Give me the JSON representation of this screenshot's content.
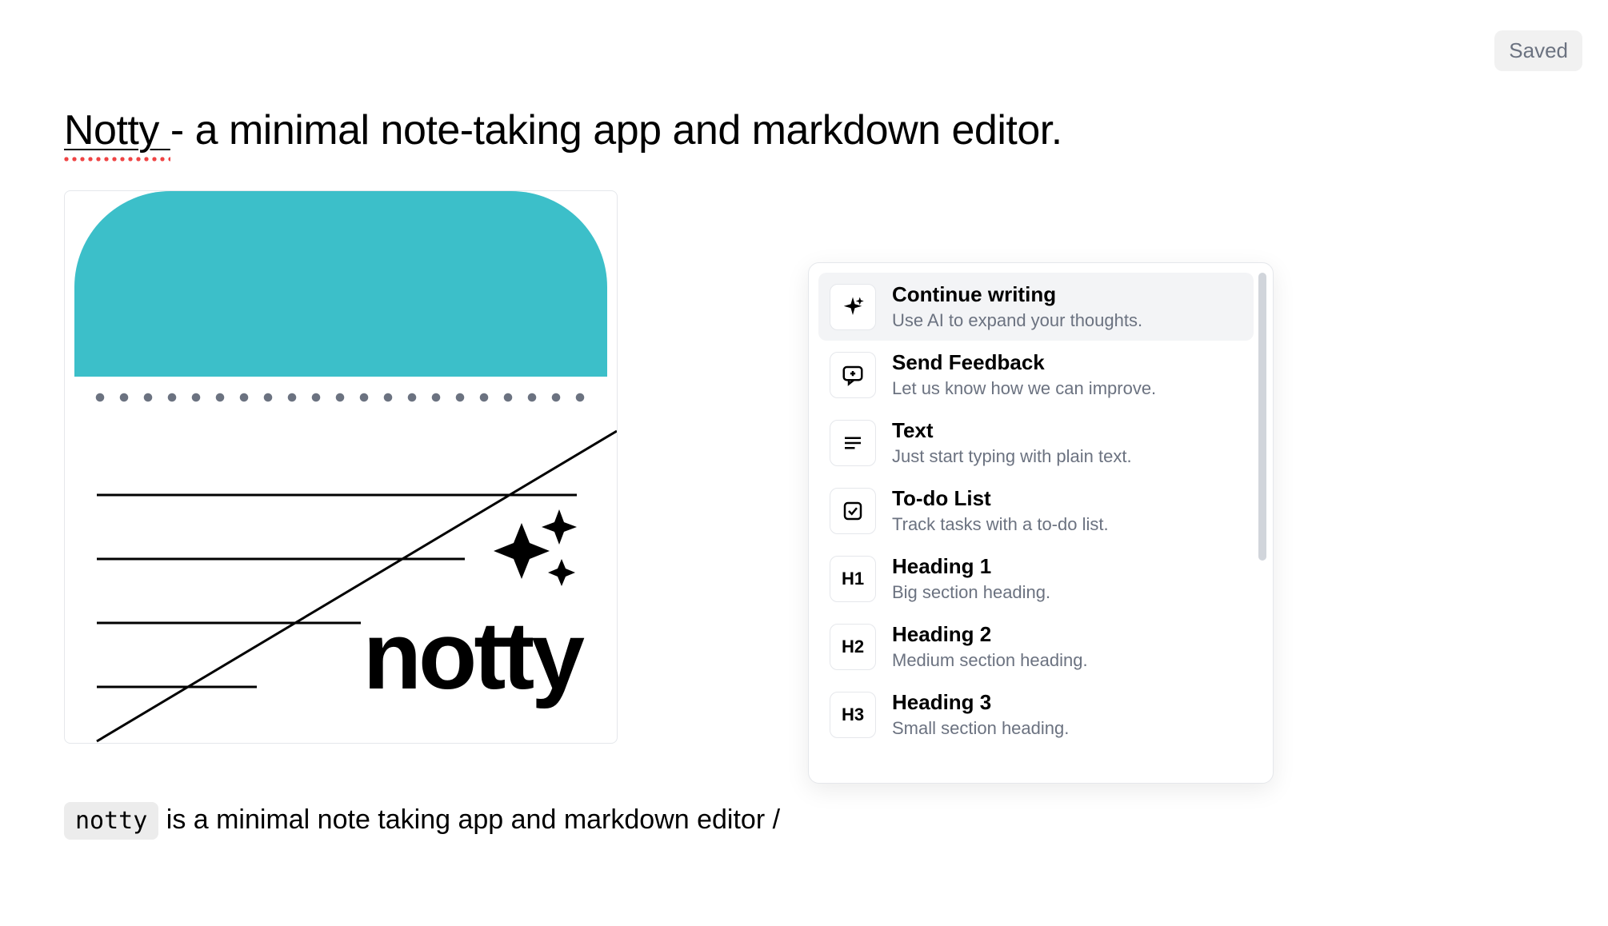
{
  "status": {
    "saved_label": "Saved"
  },
  "title": {
    "word": "Notty",
    "rest": " - a minimal note-taking app and markdown editor."
  },
  "logo": {
    "brand_word": "notty",
    "accent_color": "#3cbfc9"
  },
  "body": {
    "code": "notty",
    "text": " is a minimal note taking app and markdown editor /"
  },
  "slash_menu": {
    "selected_index": 0,
    "items": [
      {
        "icon": "sparkle-icon",
        "title": "Continue writing",
        "desc": "Use AI to expand your thoughts."
      },
      {
        "icon": "feedback-icon",
        "title": "Send Feedback",
        "desc": "Let us know how we can improve."
      },
      {
        "icon": "text-icon",
        "title": "Text",
        "desc": "Just start typing with plain text."
      },
      {
        "icon": "todo-icon",
        "title": "To-do List",
        "desc": "Track tasks with a to-do list."
      },
      {
        "icon": "h1-icon",
        "title": "Heading 1",
        "desc": "Big section heading."
      },
      {
        "icon": "h2-icon",
        "title": "Heading 2",
        "desc": "Medium section heading."
      },
      {
        "icon": "h3-icon",
        "title": "Heading 3",
        "desc": "Small section heading."
      }
    ],
    "icon_glyphs": {
      "h1-icon": "H1",
      "h2-icon": "H2",
      "h3-icon": "H3"
    }
  }
}
